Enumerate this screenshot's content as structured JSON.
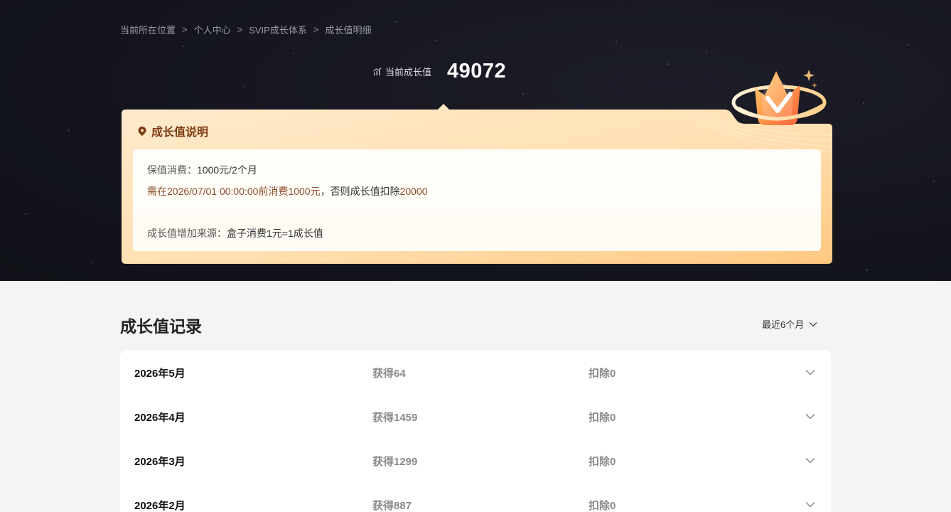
{
  "breadcrumb": {
    "items": [
      "当前所在位置",
      "个人中心",
      "SVIP成长体系",
      "成长值明细"
    ],
    "separator": ">"
  },
  "growth": {
    "label": "当前成长值",
    "value": "49072"
  },
  "explanation": {
    "title": "成长值说明",
    "keep_label": "保值消费：",
    "keep_value": "1000元/2个月",
    "warning_part1": "需在2026/07/01 00:00:00前消费1000元",
    "warning_part2": "，否则成长值扣除",
    "warning_part3": "20000",
    "source_label": "成长值增加来源：",
    "source_value": "盒子消费1元=1成长值"
  },
  "records": {
    "title": "成长值记录",
    "filter_label": "最近6个月",
    "rows": [
      {
        "month": "2026年5月",
        "gain": "获得64",
        "deduct": "扣除0"
      },
      {
        "month": "2026年4月",
        "gain": "获得1459",
        "deduct": "扣除0"
      },
      {
        "month": "2026年3月",
        "gain": "获得1299",
        "deduct": "扣除0"
      },
      {
        "month": "2026年2月",
        "gain": "获得887",
        "deduct": "扣除0"
      }
    ]
  },
  "colors": {
    "hero_bg": "#14151d",
    "card_gradient_start": "#ffe9c8",
    "card_gradient_end": "#ffc982",
    "title_brown": "#7a3a12",
    "warning_brown": "#8a4a28",
    "page_bg": "#f4f4f4"
  },
  "icons": {
    "growth": "chart-bars-icon",
    "title": "location-pin-icon",
    "crown": "crown-badge-icon",
    "dropdown": "chevron-down-icon"
  }
}
